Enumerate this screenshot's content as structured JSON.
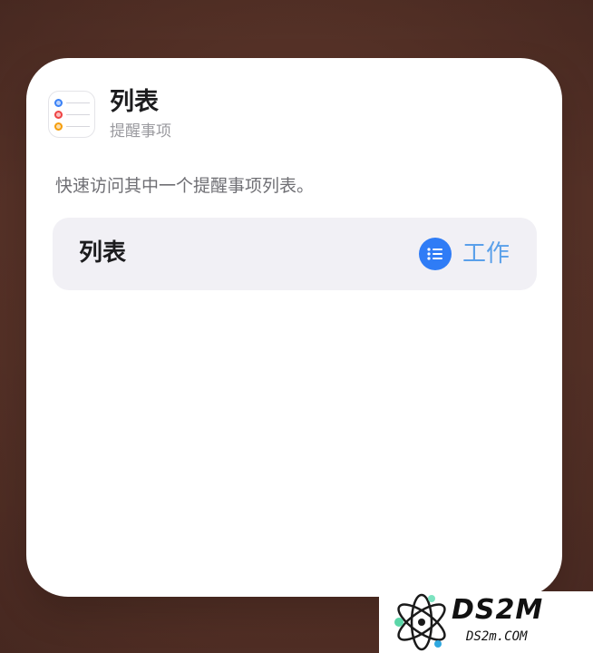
{
  "widget": {
    "title": "列表",
    "subtitle": "提醒事项",
    "description": "快速访问其中一个提醒事项列表。",
    "app_icon": {
      "name": "reminders-app-icon",
      "dot_colors": [
        "#3b82f6",
        "#ef4444",
        "#f59e0b"
      ]
    }
  },
  "parameter_row": {
    "label": "列表",
    "value": "工作",
    "value_icon": "list-bullet-icon",
    "value_icon_color": "#2f7cf6",
    "value_text_color": "#5aa0ea"
  },
  "watermark": {
    "brand": "DS2M",
    "url": "DS2m.COM"
  },
  "colors": {
    "card": "#ffffff",
    "row_background": "#f1f0f5",
    "wallpaper": "#5a3429"
  }
}
